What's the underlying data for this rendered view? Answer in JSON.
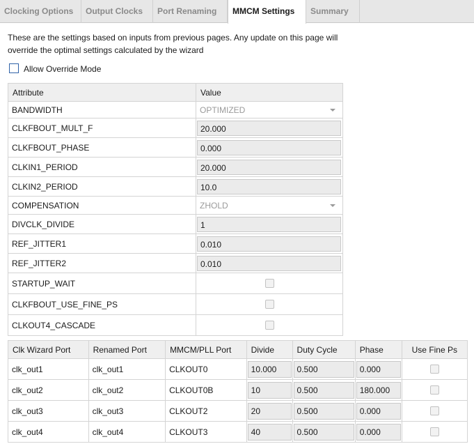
{
  "tabs": [
    {
      "label": "Clocking Options"
    },
    {
      "label": "Output Clocks"
    },
    {
      "label": "Port Renaming"
    },
    {
      "label": "MMCM Settings"
    },
    {
      "label": "Summary"
    }
  ],
  "active_tab": "MMCM Settings",
  "intro_text": "These are the settings based on inputs from previous pages. Any update on this page will override the optimal settings calculated by the wizard",
  "override": {
    "label": "Allow Override Mode",
    "checked": false
  },
  "attributes": {
    "header": {
      "attribute": "Attribute",
      "value": "Value"
    },
    "rows": [
      {
        "name": "BANDWIDTH",
        "value": "OPTIMIZED"
      },
      {
        "name": "CLKFBOUT_MULT_F",
        "value": "20.000"
      },
      {
        "name": "CLKFBOUT_PHASE",
        "value": "0.000"
      },
      {
        "name": "CLKIN1_PERIOD",
        "value": "20.000"
      },
      {
        "name": "CLKIN2_PERIOD",
        "value": "10.0"
      },
      {
        "name": "COMPENSATION",
        "value": "ZHOLD"
      },
      {
        "name": "DIVCLK_DIVIDE",
        "value": "1"
      },
      {
        "name": "REF_JITTER1",
        "value": "0.010"
      },
      {
        "name": "REF_JITTER2",
        "value": "0.010"
      },
      {
        "name": "STARTUP_WAIT",
        "value": ""
      },
      {
        "name": "CLKFBOUT_USE_FINE_PS",
        "value": ""
      },
      {
        "name": "CLKOUT4_CASCADE",
        "value": ""
      }
    ]
  },
  "ports": {
    "headers": [
      "Clk Wizard Port",
      "Renamed Port",
      "MMCM/PLL Port",
      "Divide",
      "Duty Cycle",
      "Phase",
      "Use Fine Ps"
    ],
    "rows": [
      {
        "wizard_port": "clk_out1",
        "renamed_port": "clk_out1",
        "mmcm_port": "CLKOUT0",
        "divide": "10.000",
        "duty_cycle": "0.500",
        "phase": "0.000"
      },
      {
        "wizard_port": "clk_out2",
        "renamed_port": "clk_out2",
        "mmcm_port": "CLKOUT0B",
        "divide": "10",
        "duty_cycle": "0.500",
        "phase": "180.000"
      },
      {
        "wizard_port": "clk_out3",
        "renamed_port": "clk_out3",
        "mmcm_port": "CLKOUT2",
        "divide": "20",
        "duty_cycle": "0.500",
        "phase": "0.000"
      },
      {
        "wizard_port": "clk_out4",
        "renamed_port": "clk_out4",
        "mmcm_port": "CLKOUT3",
        "divide": "40",
        "duty_cycle": "0.500",
        "phase": "0.000"
      }
    ]
  }
}
